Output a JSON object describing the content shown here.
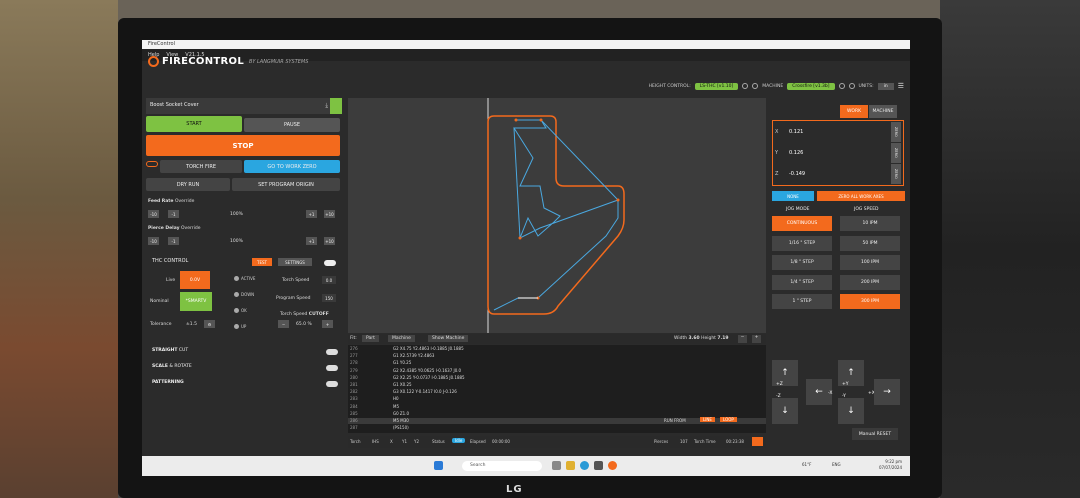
{
  "window": {
    "title": "FireControl"
  },
  "menu": [
    "Help",
    "View",
    "V21.1.5"
  ],
  "brand": {
    "name": "FIRECONTROL",
    "sub": "BY LANGMUIR SYSTEMS"
  },
  "header": {
    "height_control_label": "HEIGHT CONTROL:",
    "height_control_value": "LS-THC [v1.10]",
    "machine_label": "MACHINE",
    "machine_value": "Crossfire [v1.3b]",
    "units_label": "UNITS:",
    "units_value": "in"
  },
  "file": {
    "name": "Boost Socket Cover"
  },
  "controls": {
    "start": "START",
    "pause": "PAUSE",
    "stop": "STOP",
    "torch_fire": "TORCH FIRE",
    "go_to_work_zero": "GO TO WORK ZERO",
    "dry_run": "DRY RUN",
    "set_program_origin": "SET PROGRAM ORIGIN"
  },
  "feed_rate": {
    "label": "Feed Rate",
    "sub": "Override",
    "value": "100%",
    "dec10": "-10",
    "dec1": "-1",
    "inc1": "+1",
    "inc10": "+10"
  },
  "pierce_delay": {
    "label": "Pierce Delay",
    "sub": "Override",
    "value": "100%",
    "dec10": "-10",
    "dec1": "-1",
    "inc1": "+1",
    "inc10": "+10"
  },
  "thc": {
    "title": "THC CONTROL",
    "test": "TEST",
    "settings": "SETTINGS",
    "live_label": "Live",
    "live_value": "0.0V",
    "nominal_label": "Nominal",
    "nominal_value": "*SMARTV",
    "tolerance_label": "Tolerance",
    "tolerance_value": "±1.5",
    "states": [
      "ACTIVE",
      "DOWN",
      "OK",
      "UP"
    ],
    "torch_speed_label": "Torch Speed",
    "torch_speed_value": "0.0",
    "program_speed_label": "Program Speed",
    "program_speed_value": "150",
    "torch_speed_cutoff_label": "Torch Speed",
    "cutoff": "CUTOFF",
    "cutoff_value": "65.0 %"
  },
  "sections": [
    {
      "title": "STRAIGHT",
      "sub": "CUT"
    },
    {
      "title": "SCALE",
      "sub": "& ROTATE"
    },
    {
      "title": "PATTERNING",
      "sub": ""
    }
  ],
  "canvas_bar": {
    "fit": "Fit:",
    "part": "Part",
    "machine": "Machine",
    "show_machine": "Show Machine",
    "width_label": "Width",
    "width": "3.60",
    "height_label": "Height",
    "height": "7.19"
  },
  "gcode": [
    {
      "n": "276",
      "t": "G2 X4.75 Y2.4863 I-0.1885 J0.1885"
    },
    {
      "n": "277",
      "t": "G1 X2.5739 Y2.4863"
    },
    {
      "n": "278",
      "t": "G1 Y0.25"
    },
    {
      "n": "279",
      "t": "G2 X2.4385 Y0.0625 I-0.1637 J0.0"
    },
    {
      "n": "280",
      "t": "G2 X2.25 Y-0.0737 I-0.1885 J0.1885"
    },
    {
      "n": "281",
      "t": "G1 X0.25"
    },
    {
      "n": "282",
      "t": "G3 X0.122 Y-0.1417 I0.0 J-0.126"
    },
    {
      "n": "283",
      "t": "H0"
    },
    {
      "n": "284",
      "t": "M5"
    },
    {
      "n": "285",
      "t": "G0 Z1.0"
    },
    {
      "n": "286",
      "t": "M5 M30"
    },
    {
      "n": "287",
      "t": "(PS150)"
    }
  ],
  "run_from": {
    "label": "RUN FROM",
    "line": "LINE",
    "loop": "LOOP"
  },
  "status": {
    "torch": "Torch",
    "thc": "IHS",
    "x": "X",
    "y1": "Y1",
    "y2": "Y2",
    "status_label": "Status",
    "status_value": "Idle",
    "elapsed_label": "Elapsed",
    "elapsed": "00:00:00",
    "pierces_label": "Pierces",
    "pierces": "107",
    "torch_time_label": "Torch Time",
    "torch_time": "00:23:38"
  },
  "coords": {
    "tab_work": "WORK",
    "tab_machine": "MACHINE",
    "x": "0.121",
    "y": "0.126",
    "z": "-0.149",
    "zero": "ZERO",
    "none": "NONE",
    "zero_all": "ZERO ALL WORK AXES"
  },
  "jog": {
    "mode_label": "JOG MODE",
    "speed_label": "JOG SPEED",
    "modes": [
      "CONTINUOUS",
      "1/16 \" STEP",
      "1/8 \" STEP",
      "1/4 \" STEP",
      "1 \" STEP"
    ],
    "speeds": [
      "10 IPM",
      "50 IPM",
      "100 IPM",
      "200 IPM",
      "300 IPM"
    ],
    "active_mode": 0,
    "active_speed": 4,
    "arrow_up": "↑",
    "arrow_down": "↓",
    "arrow_left": "←",
    "arrow_right": "→",
    "plus_z": "+Z",
    "minus_z": "-Z",
    "plus_y": "+Y",
    "minus_y": "-Y",
    "minus_x": "-X",
    "plus_x": "+X",
    "manual_reset": "Manual RESET"
  },
  "taskbar": {
    "search": "Search",
    "temp": "61°F",
    "time": "9:22 pm",
    "date": "07/07/2024",
    "lang": "ENG"
  },
  "monitor_brand": "LG",
  "colors": {
    "orange": "#f36a1d",
    "green": "#7ec242",
    "blue": "#2aa6e0"
  }
}
